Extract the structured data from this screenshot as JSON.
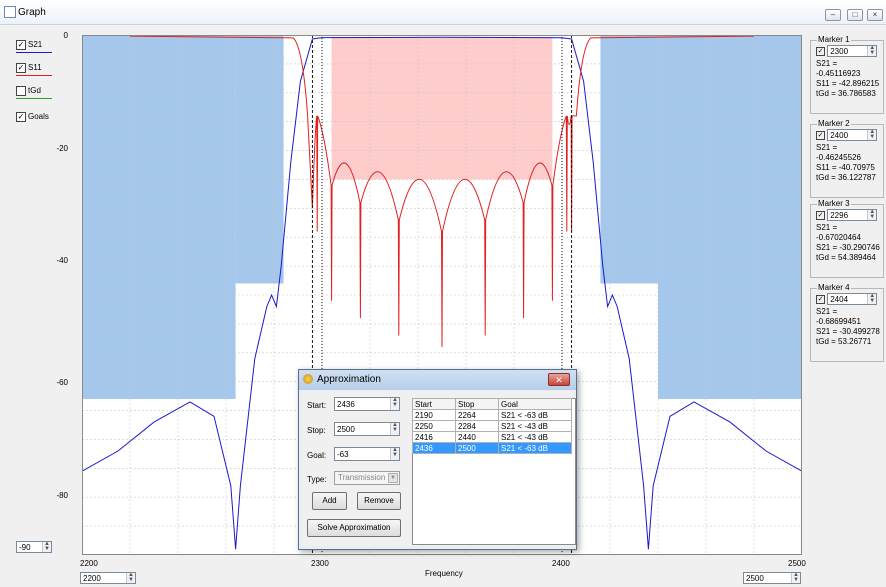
{
  "window": {
    "title": "Graph"
  },
  "legend": {
    "s21": "S21",
    "s11": "S11",
    "tgd": "tGd",
    "goals": "Goals"
  },
  "y_ticks": [
    "0",
    "-20",
    "-40",
    "-60",
    "-80"
  ],
  "x_ticks": [
    "2200",
    "2300",
    "2400",
    "2500"
  ],
  "axis": {
    "xlabel": "Frequency"
  },
  "controls": {
    "ymin": "-90",
    "xmin": "2200",
    "xmax": "2500"
  },
  "markers": [
    {
      "title": "Marker 1",
      "value": "2300",
      "line1": "S21 = -0.45116923",
      "line2": "S11 = -42.896215",
      "line3": "tGd = 36.786583"
    },
    {
      "title": "Marker 2",
      "value": "2400",
      "line1": "S21 = -0.46245526",
      "line2": "S11 = -40.70975",
      "line3": "tGd = 36.122787"
    },
    {
      "title": "Marker 3",
      "value": "2296",
      "line1": "S21 = -0.67020464",
      "line2": "S21 = -30.290746",
      "line3": "tGd = 54.389464"
    },
    {
      "title": "Marker 4",
      "value": "2404",
      "line1": "S21 = -0.68699451",
      "line2": "S21 = -30.499278",
      "line3": "tGd = 53.26771"
    }
  ],
  "dialog": {
    "title": "Approximation",
    "start_label": "Start:",
    "start_value": "2436",
    "stop_label": "Stop:",
    "stop_value": "2500",
    "goal_label": "Goal:",
    "goal_value": "-63",
    "type_label": "Type:",
    "type_value": "Transmission",
    "add_label": "Add",
    "remove_label": "Remove",
    "solve_label": "Solve Approximation",
    "table_headers": [
      "Start",
      "Stop",
      "Goal"
    ],
    "rows": [
      [
        "2190",
        "2264",
        "S21 < -63 dB"
      ],
      [
        "2250",
        "2284",
        "S21 < -43 dB"
      ],
      [
        "2416",
        "2440",
        "S21 < -43 dB"
      ],
      [
        "2436",
        "2500",
        "S21 < -63 dB"
      ]
    ]
  },
  "colors": {
    "s21": "#1a1ac8",
    "s11": "#e02020",
    "goal_fill": "#a5c7ec",
    "pass_fill": "#ffcccc"
  }
}
